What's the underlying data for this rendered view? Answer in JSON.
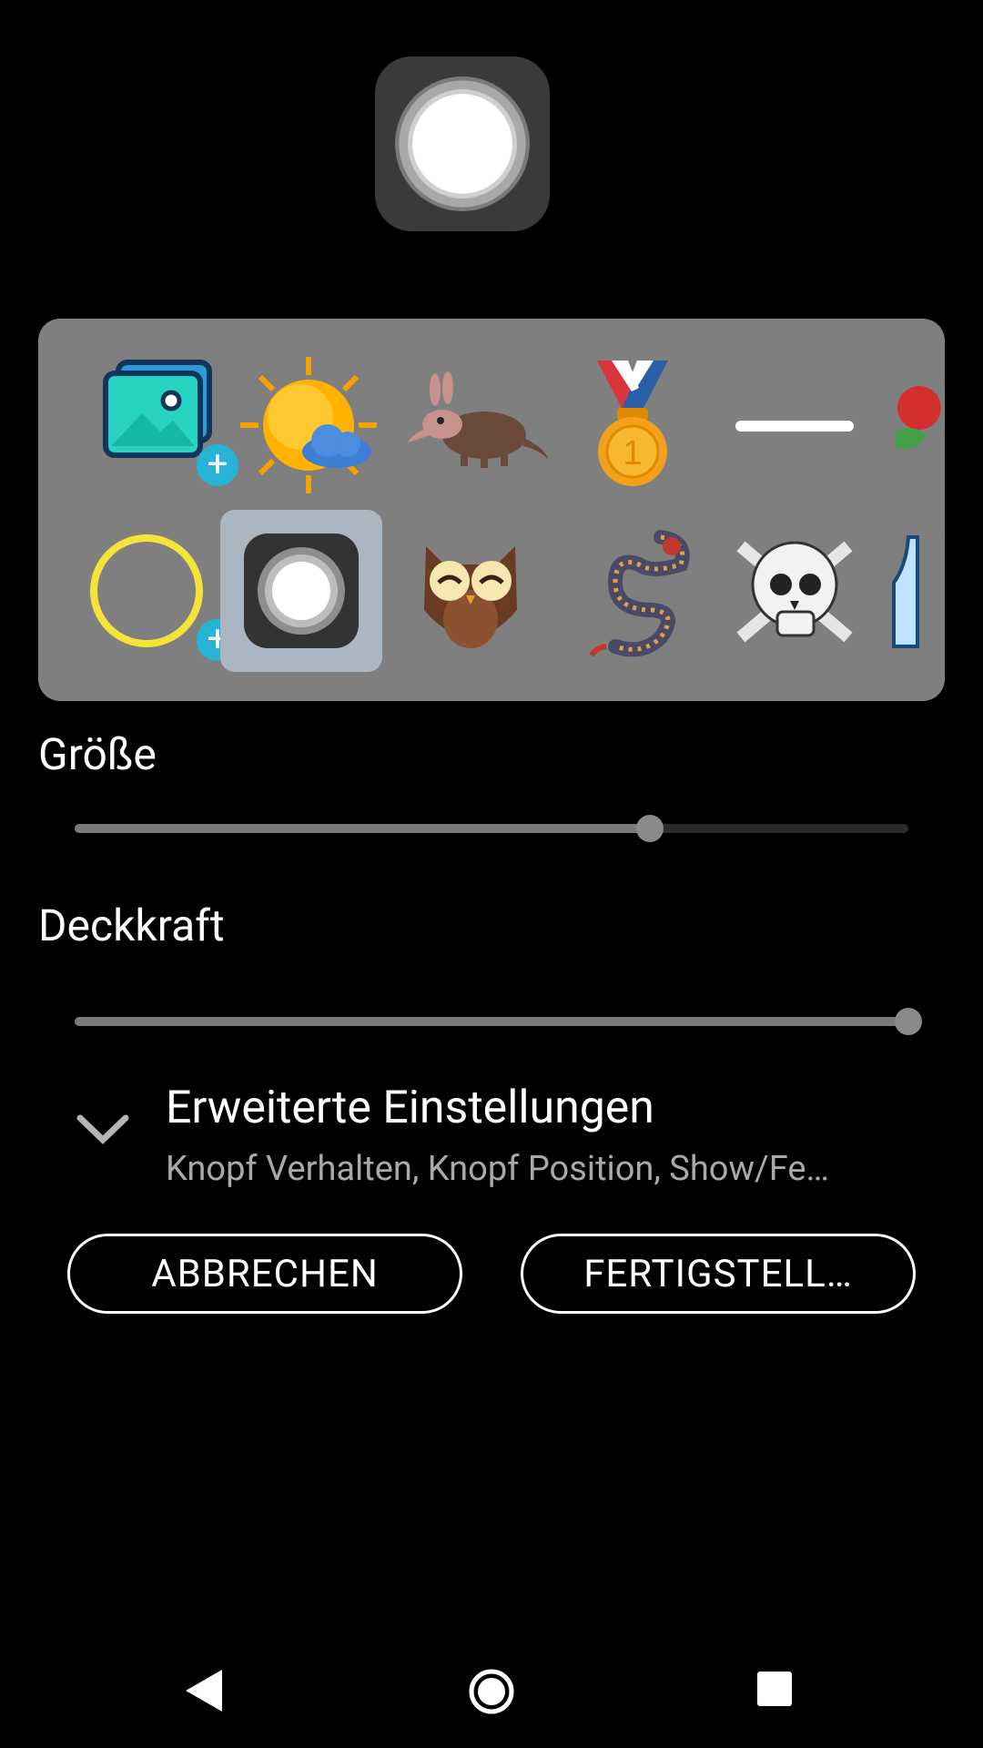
{
  "picker": {
    "row1": [
      "gallery-add-icon",
      "sun-cloud-icon",
      "aardvark-icon",
      "medal-icon",
      "line-icon",
      "rose-icon"
    ],
    "row2": [
      "circle-add-icon",
      "default-button-icon",
      "owl-icon",
      "dragon-icon",
      "skull-icon",
      "bottle-icon"
    ],
    "selected": "default-button-icon"
  },
  "size": {
    "label": "Größe",
    "value": 0.69
  },
  "opacity": {
    "label": "Deckkraft",
    "value": 1.0
  },
  "advanced": {
    "title": "Erweiterte Einstellungen",
    "subtitle": "Knopf Verhalten, Knopf Position, Show/Fe…"
  },
  "buttons": {
    "cancel": "ABBRECHEN",
    "done": "FERTIGSTELL…"
  },
  "colors": {
    "accent_badge": "#26b3d6",
    "panel": "#7f7f7f",
    "selected_cell": "#aab6c1",
    "yellow_ring": "#f5e33a"
  },
  "nav": {
    "back": "back-icon",
    "home": "home-icon",
    "recents": "recents-icon"
  }
}
